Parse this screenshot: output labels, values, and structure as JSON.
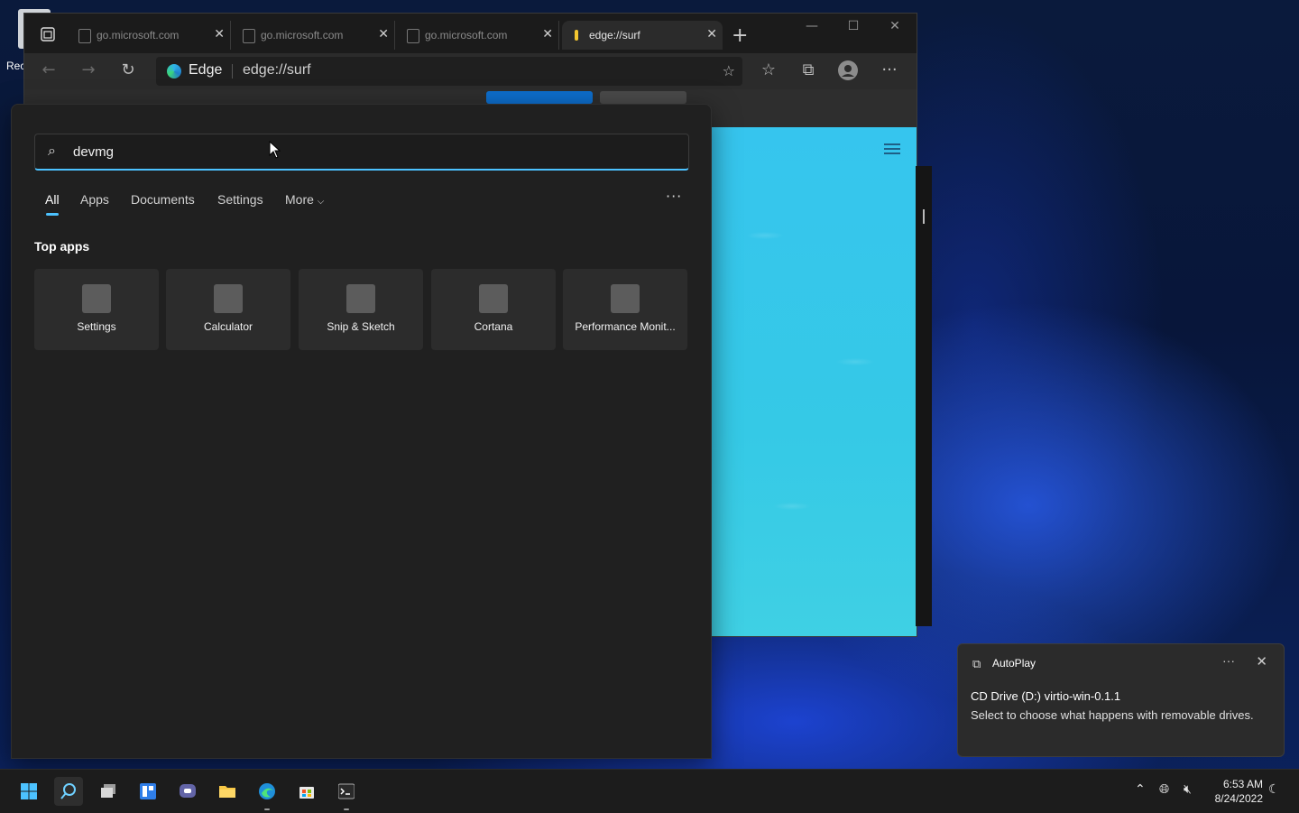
{
  "desktop": {
    "icon_label": "Rec"
  },
  "browser": {
    "tabs": [
      {
        "title": "go.microsoft.com",
        "active": false
      },
      {
        "title": "go.microsoft.com",
        "active": false
      },
      {
        "title": "go.microsoft.com",
        "active": false
      },
      {
        "title": "edge://surf",
        "active": true
      }
    ],
    "brand": "Edge",
    "url": "edge://surf"
  },
  "search": {
    "query": "devmg",
    "tabs": [
      "All",
      "Apps",
      "Documents",
      "Settings",
      "More"
    ],
    "section_title": "Top apps",
    "apps": [
      {
        "name": "Settings"
      },
      {
        "name": "Calculator"
      },
      {
        "name": "Snip & Sketch"
      },
      {
        "name": "Cortana"
      },
      {
        "name": "Performance Monit..."
      }
    ]
  },
  "notification": {
    "app": "AutoPlay",
    "title": "CD Drive (D:) virtio-win-0.1.1",
    "body": "Select to choose what happens with removable drives."
  },
  "taskbar": {
    "apps": [
      "start",
      "search",
      "task-view",
      "widgets",
      "chat",
      "file-explorer",
      "edge",
      "store",
      "terminal"
    ],
    "time": "6:53 AM",
    "date": "8/24/2022"
  },
  "colors": {
    "accent": "#4cc2ff",
    "surf_bg": "#36c5ee",
    "panel_bg": "#202020"
  }
}
